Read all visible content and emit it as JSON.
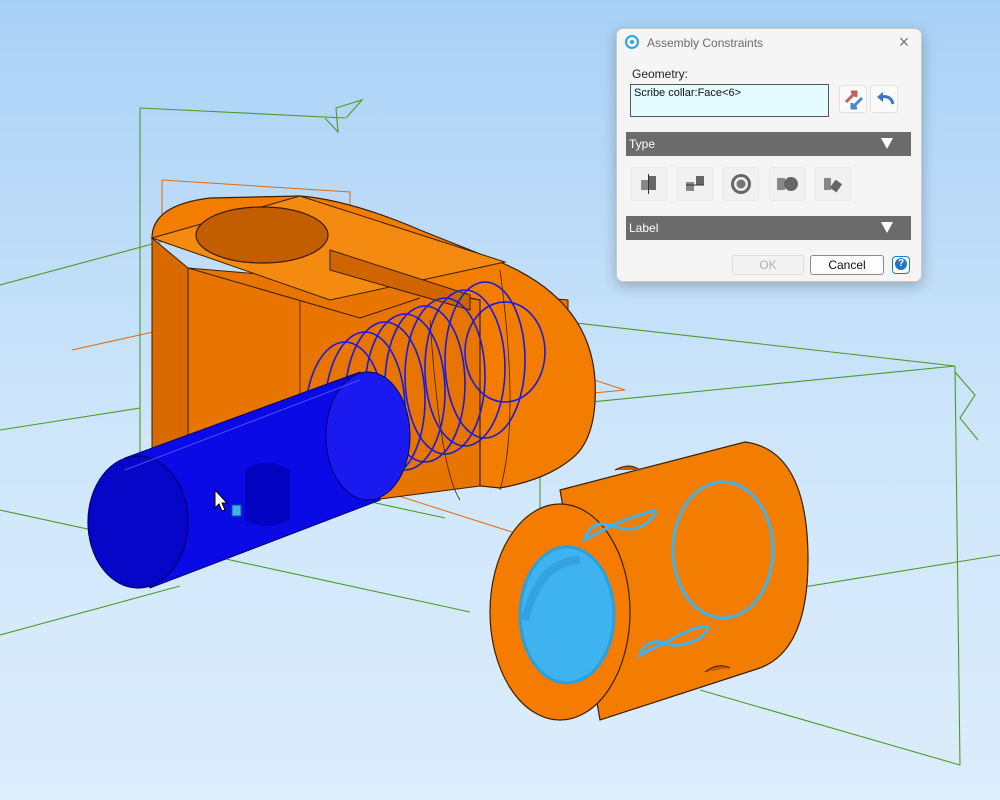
{
  "dialog": {
    "title": "Assembly Constraints",
    "geometry_label": "Geometry:",
    "geometry_value": "Scribe collar:Face<6>",
    "type_section": "Type",
    "label_section": "Label",
    "ok_label": "OK",
    "cancel_label": "Cancel",
    "help_glyph": "?",
    "close_glyph": "×",
    "type_icons": [
      "mate-icon",
      "flush-icon",
      "concentric-icon",
      "tangent-icon",
      "angle-icon"
    ]
  },
  "viewport": {
    "body_color": "#f57c00",
    "shaft_color": "#0a0ae6",
    "highlight_color": "#3fb3f0",
    "plane_color": "#4b9a2a"
  }
}
